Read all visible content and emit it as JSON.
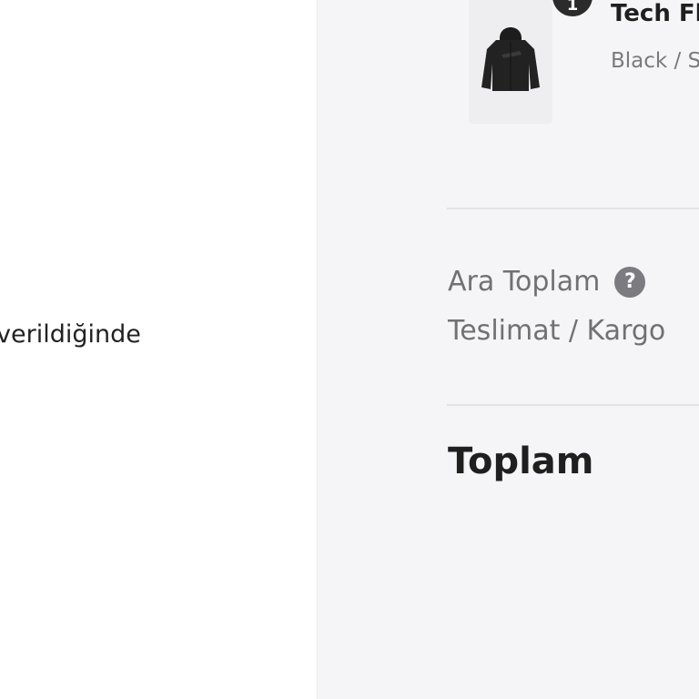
{
  "form": {
    "fragment_text": "verildiğinde"
  },
  "order_summary": {
    "item": {
      "quantity": "1",
      "name": "Tech Fl",
      "variant": "Black / S",
      "image_icon": "hoodie-icon"
    },
    "subtotal_label": "Ara Toplam",
    "help_icon_glyph": "?",
    "shipping_label": "Teslimat / Kargo",
    "total_label": "Toplam"
  },
  "colors": {
    "summary_background": "#f5f5f7",
    "badge": "#2b2b2b",
    "muted_text": "#707075"
  }
}
